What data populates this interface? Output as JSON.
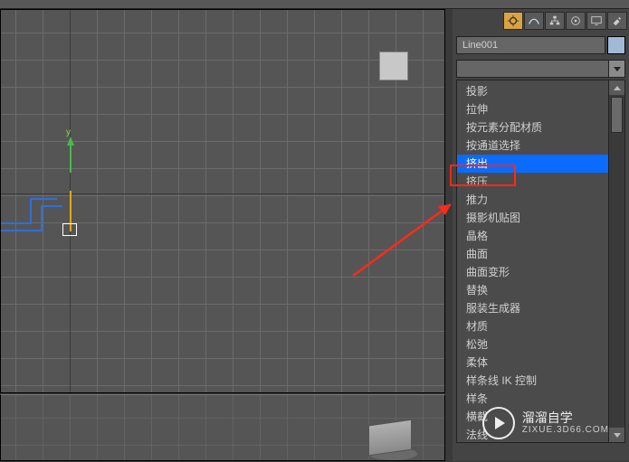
{
  "object_name": "Line001",
  "axis_label_y": "y",
  "panel_tabs": [
    "create",
    "modify",
    "hierarchy",
    "motion",
    "display",
    "utilities",
    "tools"
  ],
  "modifiers": {
    "items": [
      "投影",
      "拉伸",
      "按元素分配材质",
      "按通道选择",
      "挤出",
      "挤压",
      "推力",
      "摄影机贴图",
      "晶格",
      "曲面",
      "曲面变形",
      "替换",
      "服装生成器",
      "材质",
      "松弛",
      "柔体",
      "样条线 IK 控制",
      "样条",
      "横截",
      "法线"
    ],
    "selected_index": 4
  },
  "watermark": {
    "title": "溜溜自学",
    "sub": "ZIXUE.3D66.COM"
  }
}
